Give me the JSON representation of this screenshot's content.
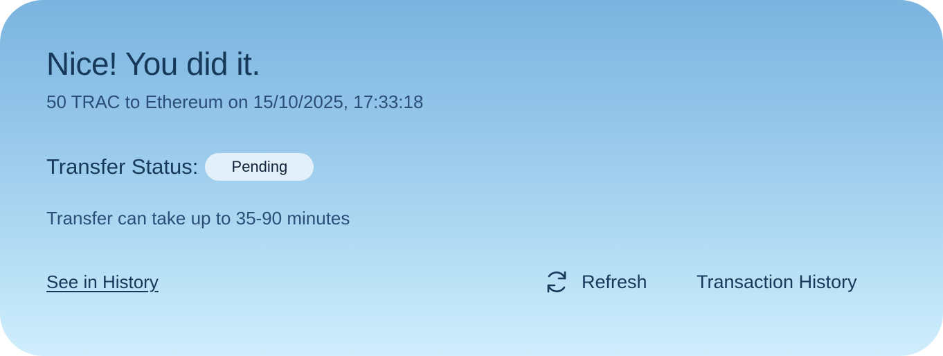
{
  "success": {
    "title": "Nice! You did it.",
    "subtitle": "50 TRAC to Ethereum on 15/10/2025, 17:33:18"
  },
  "status": {
    "label": "Transfer Status:",
    "badge": "Pending",
    "note": "Transfer can take up to 35-90 minutes"
  },
  "actions": {
    "see_history": "See in History",
    "refresh": "Refresh",
    "refresh_icon": "refresh-icon",
    "transaction_history": "Transaction History"
  },
  "colors": {
    "text_primary": "#16395a",
    "text_secondary": "#2b4e78",
    "badge_bg": "#e3f0fa",
    "card_gradient_top": "#7ab4df",
    "card_gradient_bottom": "#d0eefd"
  }
}
